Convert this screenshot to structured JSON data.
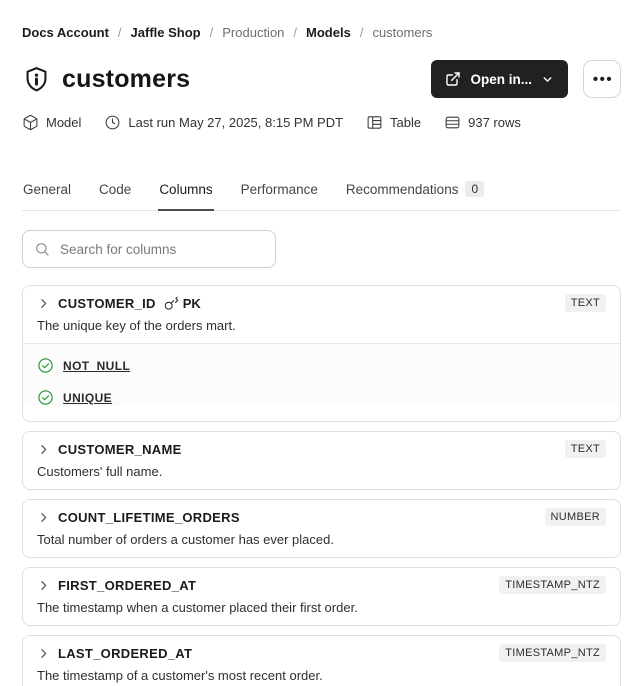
{
  "colors": {
    "accent_dark": "#212121",
    "success_green": "#2f9e44",
    "badge_bg": "#f1f1f1",
    "card_border": "#dedede",
    "muted_text": "#6e6e6e"
  },
  "breadcrumb": {
    "separator": "/",
    "items": [
      {
        "label": "Docs Account"
      },
      {
        "label": "Jaffle Shop"
      },
      {
        "label": "Production"
      },
      {
        "label": "Models"
      },
      {
        "label": "customers"
      }
    ]
  },
  "header": {
    "title": "customers",
    "open_in_label": "Open in...",
    "more_label": "•••"
  },
  "meta": {
    "items": [
      {
        "icon": "cube-icon",
        "label": "Model"
      },
      {
        "icon": "clock-icon",
        "label": "Last run May 27, 2025, 8:15 PM PDT"
      },
      {
        "icon": "table-icon",
        "label": "Table"
      },
      {
        "icon": "rows-icon",
        "label": "937 rows"
      }
    ]
  },
  "tabs": {
    "items": [
      {
        "label": "General"
      },
      {
        "label": "Code"
      },
      {
        "label": "Columns",
        "active": true
      },
      {
        "label": "Performance"
      },
      {
        "label": "Recommendations",
        "badge": "0"
      }
    ]
  },
  "search": {
    "placeholder": "Search for columns",
    "value": ""
  },
  "columns": [
    {
      "name": "CUSTOMER_ID",
      "pk_label": "PK",
      "type": "TEXT",
      "description": "The unique key of the orders mart.",
      "tests": [
        {
          "label": "NOT_NULL"
        },
        {
          "label": "UNIQUE"
        }
      ]
    },
    {
      "name": "CUSTOMER_NAME",
      "type": "TEXT",
      "description": "Customers' full name."
    },
    {
      "name": "COUNT_LIFETIME_ORDERS",
      "type": "NUMBER",
      "description": "Total number of orders a customer has ever placed."
    },
    {
      "name": "FIRST_ORDERED_AT",
      "type": "TIMESTAMP_NTZ",
      "description": "The timestamp when a customer placed their first order."
    },
    {
      "name": "LAST_ORDERED_AT",
      "type": "TIMESTAMP_NTZ",
      "description": "The timestamp of a customer's most recent order."
    }
  ]
}
